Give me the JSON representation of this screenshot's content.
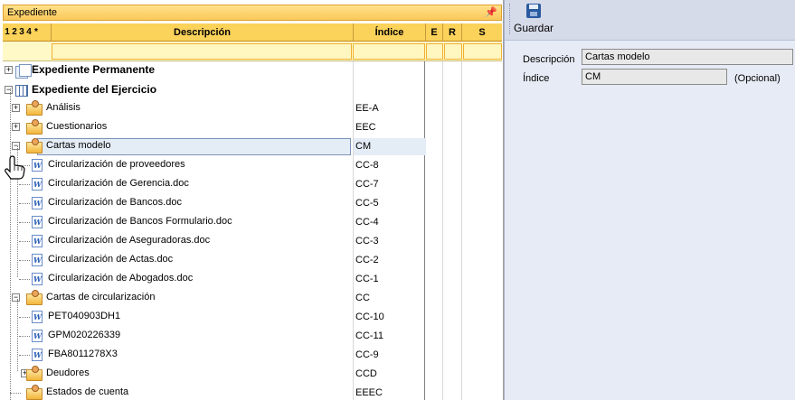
{
  "left_pane": {
    "title": "Expediente",
    "pin_glyph": "ⶫ",
    "columns": {
      "levels": [
        "1",
        "2",
        "3",
        "4",
        "*"
      ],
      "description": "Descripción",
      "index": "Índice",
      "e": "E",
      "r": "R",
      "s": "S"
    },
    "rows": [
      {
        "label": "Expediente Permanente",
        "index": "",
        "icon": "pages-icon",
        "bold": true
      },
      {
        "label": "Expediente del Ejercicio",
        "index": "",
        "icon": "table-icon",
        "bold": true
      },
      {
        "label": "Análisis",
        "index": "EE-A",
        "icon": "folder-user-icon"
      },
      {
        "label": "Cuestionarios",
        "index": "EEC",
        "icon": "folder-user-icon"
      },
      {
        "label": "Cartas modelo",
        "index": "CM",
        "icon": "folder-user-icon",
        "selected": true
      },
      {
        "label": "Circularización de proveedores",
        "index": "CC-8",
        "icon": "word-doc-icon"
      },
      {
        "label": "Circularización de Gerencia.doc",
        "index": "CC-7",
        "icon": "word-doc-icon"
      },
      {
        "label": "Circularización de Bancos.doc",
        "index": "CC-5",
        "icon": "word-doc-icon"
      },
      {
        "label": "Circularización de Bancos Formulario.doc",
        "index": "CC-4",
        "icon": "word-doc-icon"
      },
      {
        "label": "Circularización de Aseguradoras.doc",
        "index": "CC-3",
        "icon": "word-doc-icon"
      },
      {
        "label": "Circularización de Actas.doc",
        "index": "CC-2",
        "icon": "word-doc-icon"
      },
      {
        "label": "Circularización de Abogados.doc",
        "index": "CC-1",
        "icon": "word-doc-icon"
      },
      {
        "label": "Cartas de circularización",
        "index": "CC",
        "icon": "folder-user-icon"
      },
      {
        "label": "PET040903DH1",
        "index": "CC-10",
        "icon": "word-doc-icon"
      },
      {
        "label": "GPM020226339",
        "index": "CC-11",
        "icon": "word-doc-icon"
      },
      {
        "label": "FBA8011278X3",
        "index": "CC-9",
        "icon": "word-doc-icon"
      },
      {
        "label": "Deudores",
        "index": "CCD",
        "icon": "folder-user-icon"
      },
      {
        "label": "Estados de cuenta",
        "index": "EEEC",
        "icon": "folder-user-icon"
      }
    ]
  },
  "toolbar": {
    "save_label": "Guardar"
  },
  "form": {
    "description_label": "Descripción",
    "description_value": "Cartas modelo",
    "index_label": "Índice",
    "index_value": "CM",
    "index_hint": "(Opcional)"
  }
}
